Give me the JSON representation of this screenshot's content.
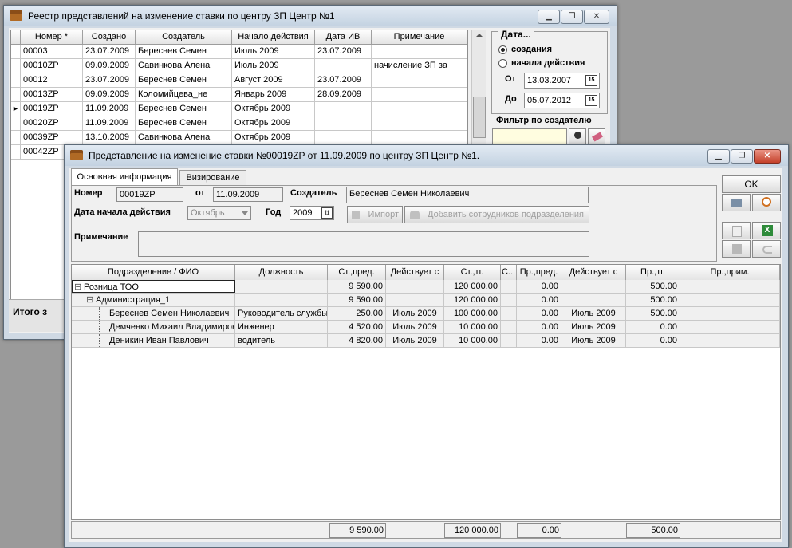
{
  "colors": {
    "desktop": "#9a9a9a",
    "window_bg": "#f0f0f0",
    "grid_bg": "#ffffff",
    "highlight": "#fffde8",
    "close_red": "#c4402a"
  },
  "registry": {
    "title": "Реестр представлений на изменение ставки по центру ЗП Центр №1",
    "columns": [
      "Номер *",
      "Создано",
      "Создатель",
      "Начало действия",
      "Дата ИВ",
      "Примечание"
    ],
    "rows": [
      [
        "00003",
        "23.07.2009",
        "Береснев Семен",
        "Июль 2009",
        "23.07.2009",
        ""
      ],
      [
        "00010ZP",
        "09.09.2009",
        "Савинкова Алена",
        "Июль 2009",
        "",
        "начисление ЗП за"
      ],
      [
        "00012",
        "23.07.2009",
        "Береснев Семен",
        "Август 2009",
        "23.07.2009",
        ""
      ],
      [
        "00013ZP",
        "09.09.2009",
        "Коломийцева_не",
        "Январь 2009",
        "28.09.2009",
        ""
      ],
      [
        "00019ZP",
        "11.09.2009",
        "Береснев Семен",
        "Октябрь 2009",
        "",
        ""
      ],
      [
        "00020ZP",
        "11.09.2009",
        "Береснев Семен",
        "Октябрь 2009",
        "",
        ""
      ],
      [
        "00039ZP",
        "13.10.2009",
        "Савинкова Алена",
        "Октябрь 2009",
        "",
        ""
      ],
      [
        "00042ZP",
        "",
        "",
        "",
        "",
        ""
      ]
    ],
    "current_row_marker": "►",
    "total_label": "Итого з",
    "filter": {
      "group_title": "Дата...",
      "options": [
        "создания",
        "начала действия"
      ],
      "from_label": "От",
      "from_value": "13.03.2007",
      "to_label": "До",
      "to_value": "05.07.2012",
      "creator_filter_label": "Фильтр по создателю",
      "creator_filter_value": ""
    },
    "controls": {
      "minimize": "▁",
      "restore": "❐",
      "close": "✕",
      "calendar": "15"
    }
  },
  "detail": {
    "title": "Представление на изменение ставки №00019ZP от 11.09.2009 по центру ЗП Центр №1.",
    "tabs": [
      "Основная информация",
      "Визирование"
    ],
    "number_label": "Номер",
    "number_value": "00019ZP",
    "date_label": "от",
    "date_value": "11.09.2009",
    "creator_label": "Создатель",
    "creator_value": "Береснев Семен Николаевич",
    "start_label": "Дата начала действия",
    "start_value": "Октябрь",
    "year_label": "Год",
    "year_value": "2009",
    "import_label": "Импорт",
    "add_staff_label": "Добавить сотрудников подразделения",
    "note_label": "Примечание",
    "note_value": "",
    "ok_label": "OK",
    "columns": [
      "Подразделение / ФИО",
      "Должность",
      "Ст.,пред.",
      "Действует с",
      "Ст.,тг.",
      "С...",
      "Пр.,пред.",
      "Действует с",
      "Пр.,тг.",
      "Пр.,прим."
    ],
    "rows": [
      {
        "level": 0,
        "toggle": "⊟",
        "name": "Розница ТОО",
        "position": "",
        "rate_pred": "9 590.00",
        "from1": "",
        "rate_tg": "120 000.00",
        "c": "",
        "pr_pred": "0.00",
        "from2": "",
        "pr_tg": "500.00",
        "pr_note": ""
      },
      {
        "level": 1,
        "toggle": "⊟",
        "name": "Администрация_1",
        "position": "",
        "rate_pred": "9 590.00",
        "from1": "",
        "rate_tg": "120 000.00",
        "c": "",
        "pr_pred": "0.00",
        "from2": "",
        "pr_tg": "500.00",
        "pr_note": ""
      },
      {
        "level": 2,
        "toggle": "",
        "name": "Береснев  Семен Николаевич",
        "position": "Руководитель службы",
        "rate_pred": "250.00",
        "from1": "Июль 2009",
        "rate_tg": "100 000.00",
        "c": "",
        "pr_pred": "0.00",
        "from2": "Июль 2009",
        "pr_tg": "500.00",
        "pr_note": ""
      },
      {
        "level": 2,
        "toggle": "",
        "name": "Демченко Михаил Владимирович",
        "position": "Инженер",
        "rate_pred": "4 520.00",
        "from1": "Июль 2009",
        "rate_tg": "10 000.00",
        "c": "",
        "pr_pred": "0.00",
        "from2": "Июль 2009",
        "pr_tg": "0.00",
        "pr_note": ""
      },
      {
        "level": 2,
        "toggle": "",
        "name": "Деникин Иван  Павлович",
        "position": "водитель",
        "rate_pred": "4 820.00",
        "from1": "Июль 2009",
        "rate_tg": "10 000.00",
        "c": "",
        "pr_pred": "0.00",
        "from2": "Июль 2009",
        "pr_tg": "0.00",
        "pr_note": ""
      }
    ],
    "totals": {
      "rate_pred": "9 590.00",
      "rate_tg": "120 000.00",
      "pr_pred": "0.00",
      "pr_tg": "500.00"
    }
  }
}
